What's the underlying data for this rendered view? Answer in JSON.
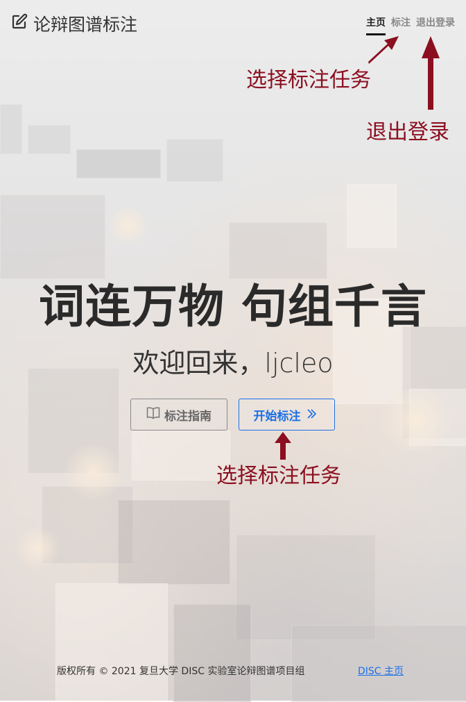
{
  "header": {
    "brand_title": "论辩图谱标注",
    "brand_icon": "edit-icon",
    "nav": [
      {
        "label": "主页",
        "active": true
      },
      {
        "label": "标注",
        "active": false
      },
      {
        "label": "退出登录",
        "active": false
      }
    ]
  },
  "hero": {
    "title": "词连万物 句组千言",
    "welcome": "欢迎回来，ljcleo",
    "guide_button": "标注指南",
    "guide_icon": "book-icon",
    "start_button": "开始标注",
    "start_icon": "double-chevron-right-icon"
  },
  "annotations": {
    "top_select": "选择标注任务",
    "top_logout": "退出登录",
    "bottom_select": "选择标注任务",
    "color": "#8b0f20"
  },
  "footer": {
    "copyright": "版权所有 © 2021 复旦大学 DISC 实验室论辩图谱项目组",
    "link": "DISC 主页"
  },
  "colors": {
    "accent": "#1a6fe8",
    "annotation": "#8b0f20"
  }
}
